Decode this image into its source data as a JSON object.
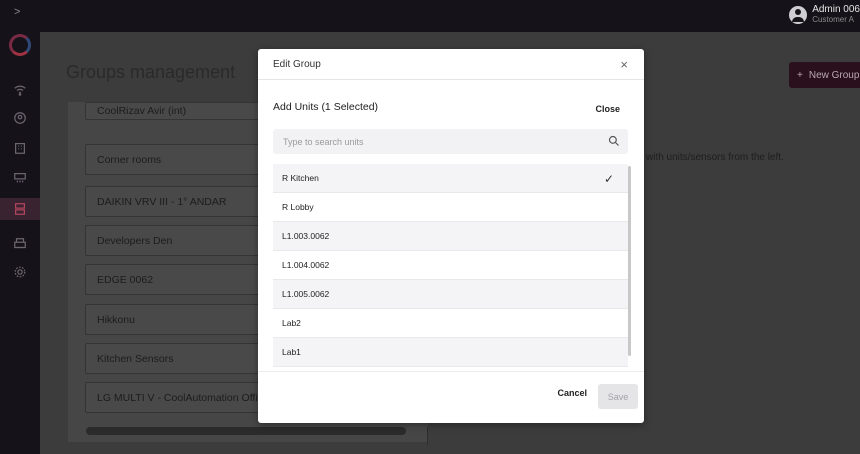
{
  "sidebar": {
    "toggle_icon": "chevron-right-icon",
    "items": [
      {
        "icon": "wifi-icon"
      },
      {
        "icon": "location-icon"
      },
      {
        "icon": "building-icon"
      },
      {
        "icon": "air-conditioner-icon"
      },
      {
        "icon": "groups-icon",
        "active": true
      },
      {
        "icon": "printer-icon"
      },
      {
        "icon": "settings-icon"
      }
    ]
  },
  "header": {
    "user_name": "Admin 006",
    "user_role": "Customer A"
  },
  "page": {
    "title": "Groups management",
    "new_group_label": "New Group",
    "hint_text": "with units/sensors from the left.",
    "groups": [
      "CoolRizav Avir (int)",
      "Corner rooms",
      "DAIKIN VRV III - 1° ANDAR",
      "Developers Den",
      "EDGE 0062",
      "Hikkonu",
      "Kitchen Sensors",
      "LG MULTI V - CoolAutomation Office"
    ]
  },
  "modal": {
    "title": "Edit Group",
    "close_symbol": "×",
    "section_title": "Add Units (1 Selected)",
    "section_close_label": "Close",
    "search_placeholder": "Type to search units",
    "check_symbol": "✓",
    "units": [
      {
        "name": "R Kitchen",
        "selected": true
      },
      {
        "name": "R Lobby",
        "selected": false
      },
      {
        "name": "L1.003.0062",
        "selected": false
      },
      {
        "name": "L1.004.0062",
        "selected": false
      },
      {
        "name": "L1.005.0062",
        "selected": false
      },
      {
        "name": "Lab2",
        "selected": false
      },
      {
        "name": "Lab1",
        "selected": false
      }
    ],
    "cancel_label": "Cancel",
    "save_label": "Save"
  },
  "colors": {
    "accent": "#2a0f1c",
    "sidebar_bg": "#161219",
    "modal_bg": "#ffffff"
  }
}
